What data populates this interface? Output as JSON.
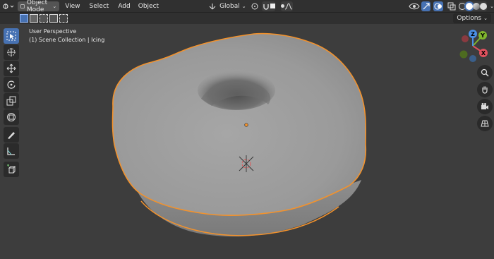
{
  "header": {
    "editor_type_icon": "3d-viewport-icon",
    "mode_label": "Object Mode",
    "menus": [
      "View",
      "Select",
      "Add",
      "Object"
    ],
    "transform_orientation": "Global",
    "options_label": "Options"
  },
  "viewport": {
    "view_name": "User Perspective",
    "collection_info": "(1) Scene Collection | Icing"
  },
  "gizmo": {
    "x_label": "X",
    "y_label": "Y",
    "z_label": "Z"
  },
  "colors": {
    "selection_outline": "#f3922c",
    "active_tool": "#4772b3",
    "mesh": "#9a9a9a"
  }
}
